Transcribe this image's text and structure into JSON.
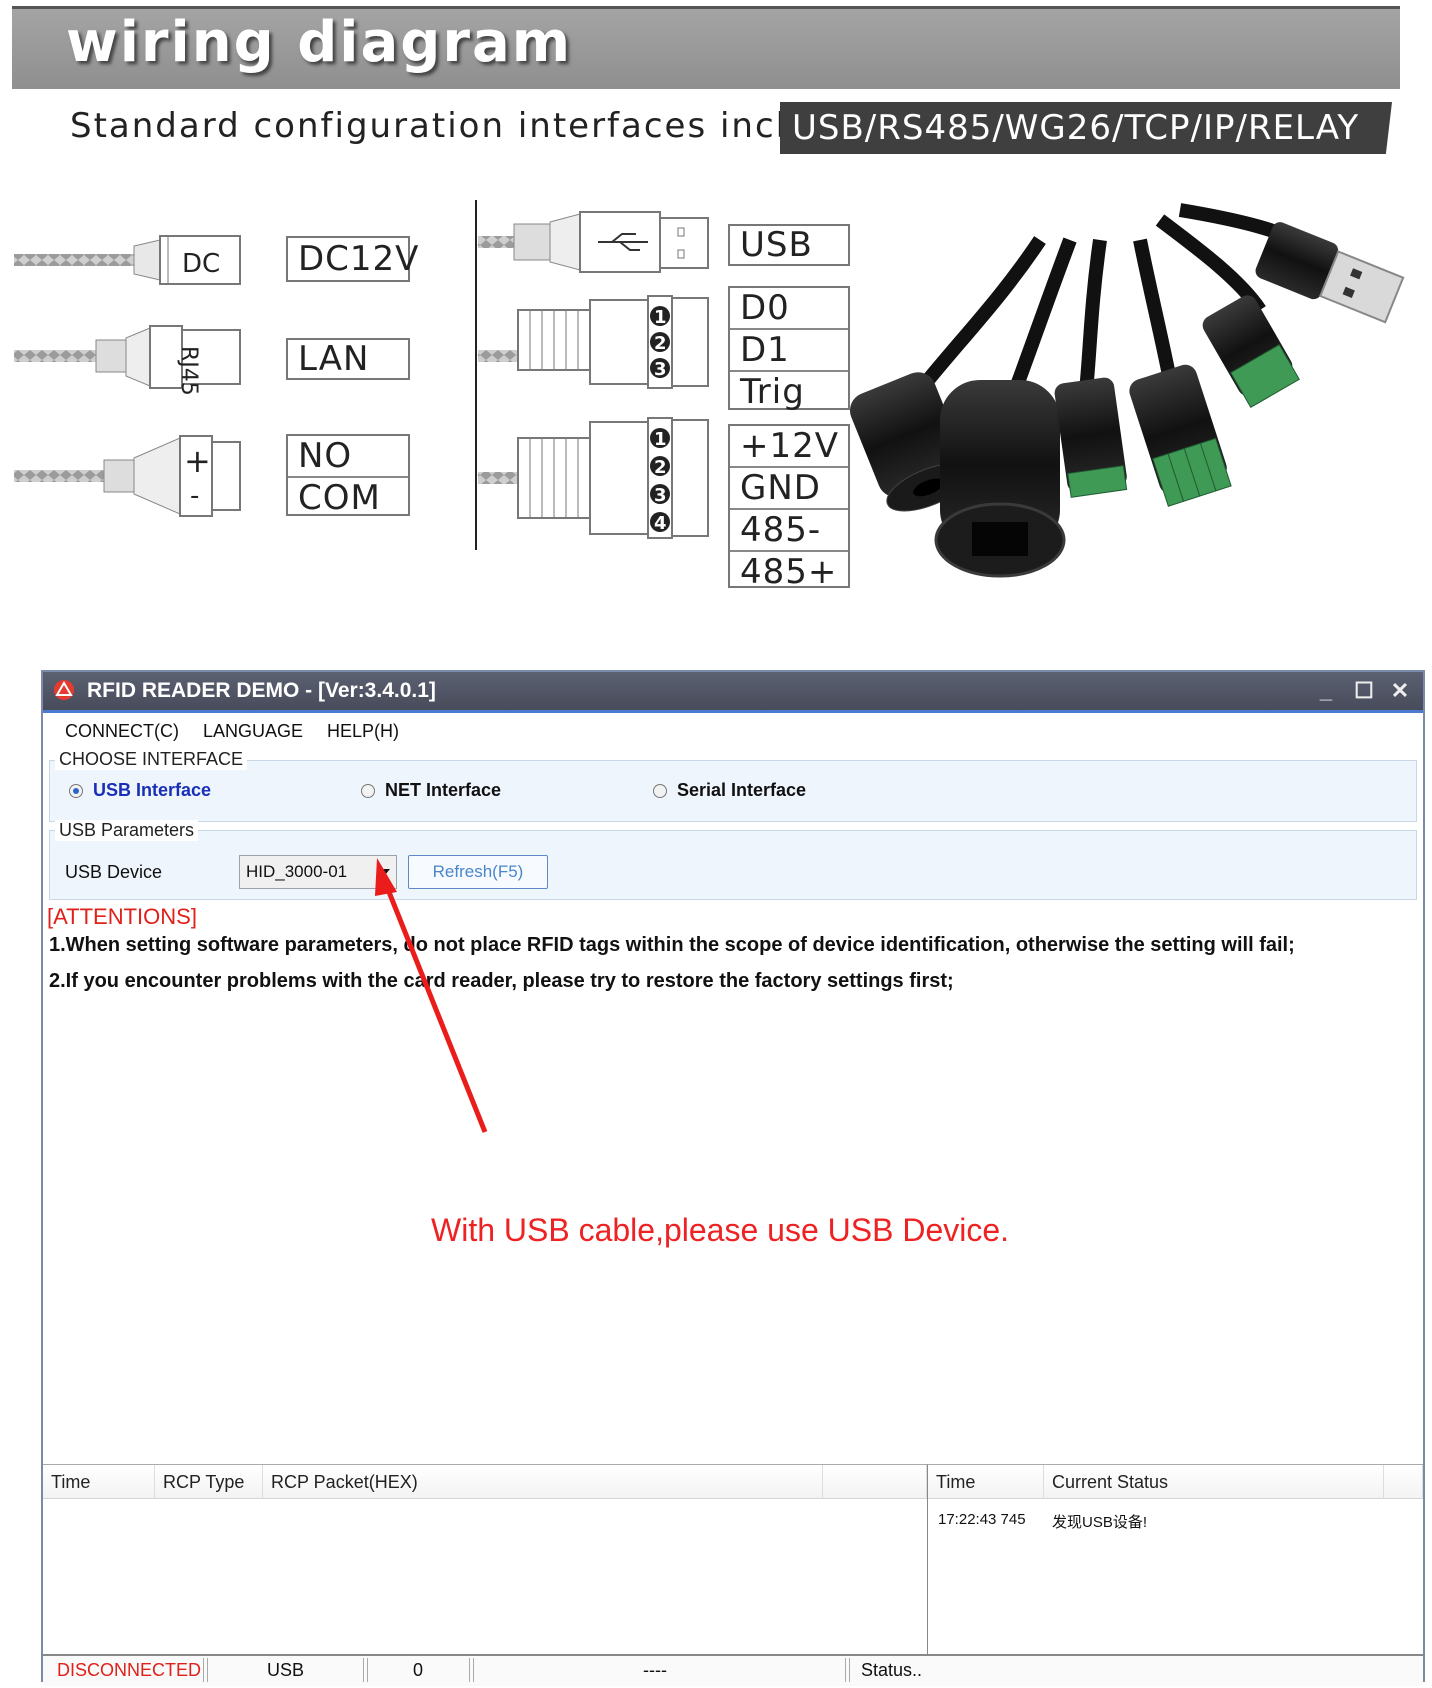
{
  "banner": {
    "title": "wiring diagram",
    "subtitle": "Standard configuration interfaces include",
    "interfaces": "USB/RS485/WG26/TCP/IP/RELAY"
  },
  "diagram": {
    "left": {
      "dc_plug_label": "DC",
      "dc_label": "DC12V",
      "rj45_plug_label": "RJ45",
      "lan_label": "LAN",
      "relay_labels": [
        "NO",
        "COM"
      ]
    },
    "right": {
      "usb_label": "USB",
      "wiegand_labels": [
        "D0",
        "D1",
        "Trig"
      ],
      "wiegand_pins": [
        "1",
        "2",
        "3"
      ],
      "rs485_labels": [
        "+12V",
        "GND",
        "485-",
        "485+"
      ],
      "rs485_pins": [
        "1",
        "2",
        "3",
        "4"
      ]
    }
  },
  "window": {
    "title": "RFID READER DEMO - [Ver:3.4.0.1]",
    "controls": {
      "minimize": "_",
      "maximize": "☐",
      "close": "✕"
    }
  },
  "menu": {
    "items": [
      "CONNECT(C)",
      "LANGUAGE",
      "HELP(H)"
    ]
  },
  "interface_group": {
    "caption": "CHOOSE INTERFACE",
    "options": [
      {
        "label": "USB Interface",
        "selected": true
      },
      {
        "label": "NET Interface",
        "selected": false
      },
      {
        "label": "Serial Interface",
        "selected": false
      }
    ]
  },
  "usb_params": {
    "caption": "USB Parameters",
    "device_label": "USB Device",
    "device_value": "HID_3000-01",
    "refresh_label": "Refresh(F5)"
  },
  "attentions": {
    "heading": "[ATTENTIONS]",
    "lines": [
      "1.When setting software parameters, do not place RFID tags within the scope of device identification, otherwise the setting will fail;",
      "2.If you encounter problems with the card reader, please try to restore the factory settings first;"
    ]
  },
  "note": "With USB cable,please use USB Device.",
  "log_left": {
    "columns": [
      "Time",
      "RCP Type",
      "RCP Packet(HEX)"
    ]
  },
  "log_right": {
    "columns": [
      "Time",
      "Current Status"
    ],
    "rows": [
      {
        "time": "17:22:43 745",
        "status": "发现USB设备!"
      }
    ]
  },
  "status_bar": {
    "connection": "DISCONNECTED",
    "interface": "USB",
    "count": "0",
    "placeholder": "----",
    "status": "Status.."
  },
  "colors": {
    "accent_red": "#e0201a",
    "title_bar": "#4f5363",
    "link_blue": "#1a2fb8"
  }
}
